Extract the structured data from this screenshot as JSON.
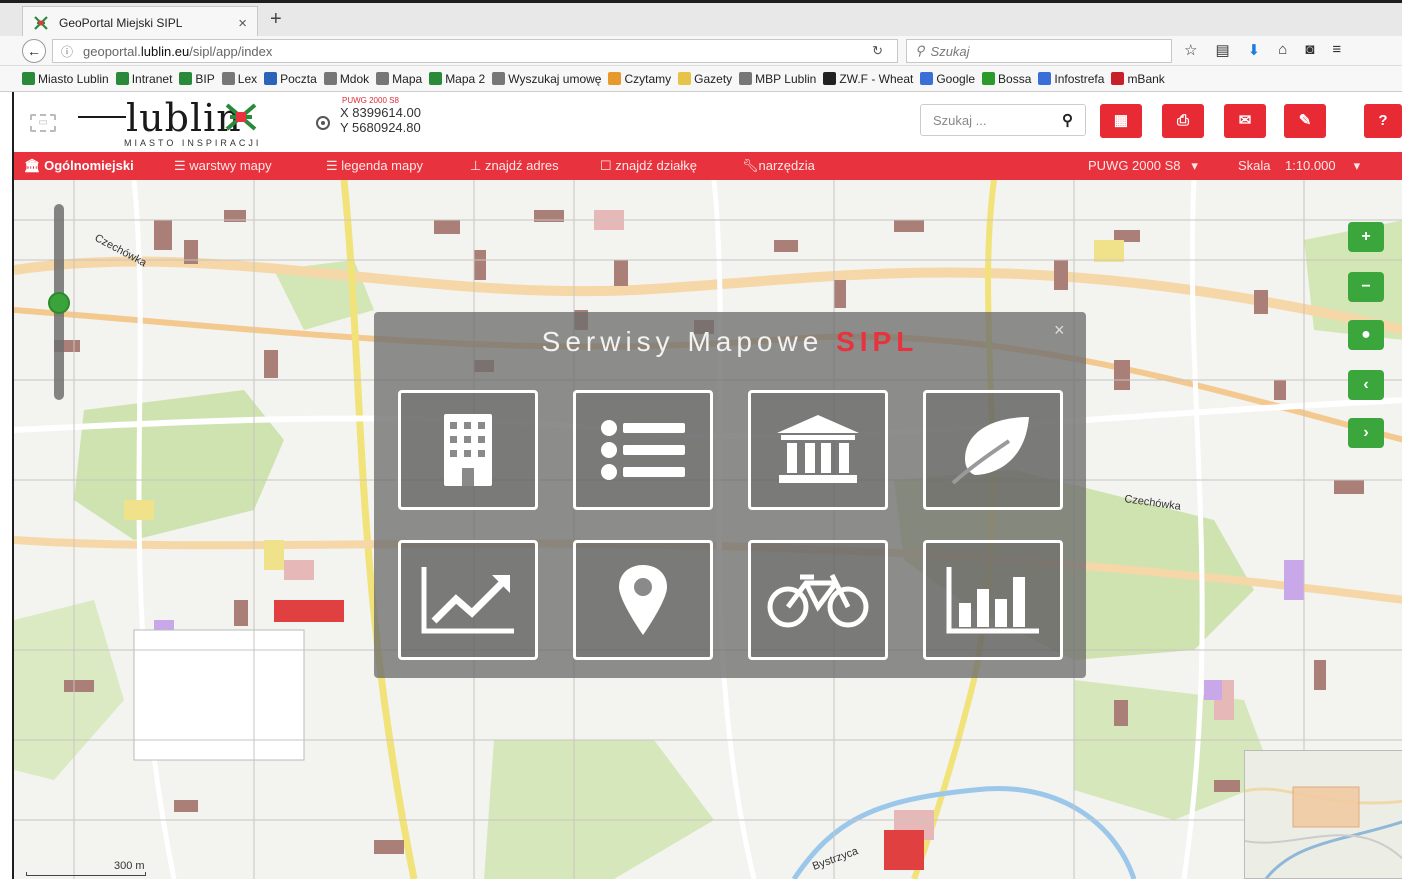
{
  "browser": {
    "tab_title": "GeoPortal Miejski SIPL",
    "url_prefix": "geoportal.",
    "url_host": "lublin.eu",
    "url_path": "/sipl/app/index",
    "search_placeholder": "Szukaj",
    "bookmarks": [
      {
        "label": "Miasto Lublin",
        "icon": "lublin-mark-icon",
        "color": "#2a8a3a"
      },
      {
        "label": "Intranet",
        "icon": "lublin-mark-icon",
        "color": "#2a8a3a"
      },
      {
        "label": "BIP",
        "icon": "lublin-mark-icon",
        "color": "#2a8a3a"
      },
      {
        "label": "Lex",
        "icon": "globe-icon",
        "color": "#777777"
      },
      {
        "label": "Poczta",
        "icon": "z-mail-icon",
        "color": "#2a63b8"
      },
      {
        "label": "Mdok",
        "icon": "globe-icon",
        "color": "#777777"
      },
      {
        "label": "Mapa",
        "icon": "globe-icon",
        "color": "#777777"
      },
      {
        "label": "Mapa 2",
        "icon": "lublin-mark-icon",
        "color": "#2a8a3a"
      },
      {
        "label": "Wyszukaj umowę",
        "icon": "globe-icon",
        "color": "#777777"
      },
      {
        "label": "Czytamy",
        "icon": "book-stack-icon",
        "color": "#e79a2c"
      },
      {
        "label": "Gazety",
        "icon": "folder-icon",
        "color": "#e8c34a"
      },
      {
        "label": "MBP Lublin",
        "icon": "globe-icon",
        "color": "#777777"
      },
      {
        "label": "ZW.F - Wheat",
        "icon": "oq-icon",
        "color": "#222222"
      },
      {
        "label": "Google",
        "icon": "google-icon",
        "color": "#3a6fd8"
      },
      {
        "label": "Bossa",
        "icon": "leaf-icon",
        "color": "#2a9a2a"
      },
      {
        "label": "Infostrefa",
        "icon": "infostrefa-icon",
        "color": "#3a6fd8"
      },
      {
        "label": "mBank",
        "icon": "mbank-icon",
        "color": "#c8202a"
      }
    ]
  },
  "header": {
    "logo_text": "lublin",
    "logo_sub": "MIASTO INSPIRACJI",
    "crs_label": "PUWG 2000 S8",
    "x_coord": "X 8399614.00",
    "y_coord": "Y 5680924.80",
    "search_placeholder": "Szukaj ...",
    "buttons": [
      {
        "name": "grid-menu-button",
        "icon": "grid-icon"
      },
      {
        "name": "print-button",
        "icon": "print-icon"
      },
      {
        "name": "mail-button",
        "icon": "envelope-icon"
      },
      {
        "name": "edit-button",
        "icon": "edit-icon"
      },
      {
        "name": "help-button",
        "icon": "question-icon"
      }
    ],
    "accent": "#e8323d"
  },
  "menu": {
    "general": "Ogólnomiejski",
    "layers": "warstwy mapy",
    "legend": "legenda mapy",
    "find_address": "znajdź adres",
    "find_parcel": "znajdź działkę",
    "tools": "narzędzia",
    "crs": "PUWG 2000 S8",
    "scale_label": "Skala",
    "scale_value": "1:10.000"
  },
  "map": {
    "labels": [
      "Czechówka",
      "Czechówka",
      "Bystrzyca"
    ],
    "scale_text": "300 m",
    "controls": [
      {
        "name": "zoom-in-button",
        "glyph": "+"
      },
      {
        "name": "zoom-out-button",
        "glyph": "−"
      },
      {
        "name": "globe-button",
        "glyph": "●"
      },
      {
        "name": "prev-extent-button",
        "glyph": "‹"
      },
      {
        "name": "next-extent-button",
        "glyph": "›"
      }
    ]
  },
  "modal": {
    "title_main": "Serwisy Mapowe",
    "title_accent": "SIPL",
    "close": "×",
    "tiles": [
      {
        "name": "service-buildings",
        "icon": "building-icon"
      },
      {
        "name": "service-list",
        "icon": "list-icon"
      },
      {
        "name": "service-institutions",
        "icon": "bank-icon"
      },
      {
        "name": "service-environment",
        "icon": "leaf-icon"
      },
      {
        "name": "service-trends",
        "icon": "trend-chart-icon"
      },
      {
        "name": "service-places",
        "icon": "map-marker-icon"
      },
      {
        "name": "service-bikes",
        "icon": "bicycle-icon"
      },
      {
        "name": "service-statistics",
        "icon": "bar-chart-icon"
      }
    ]
  }
}
